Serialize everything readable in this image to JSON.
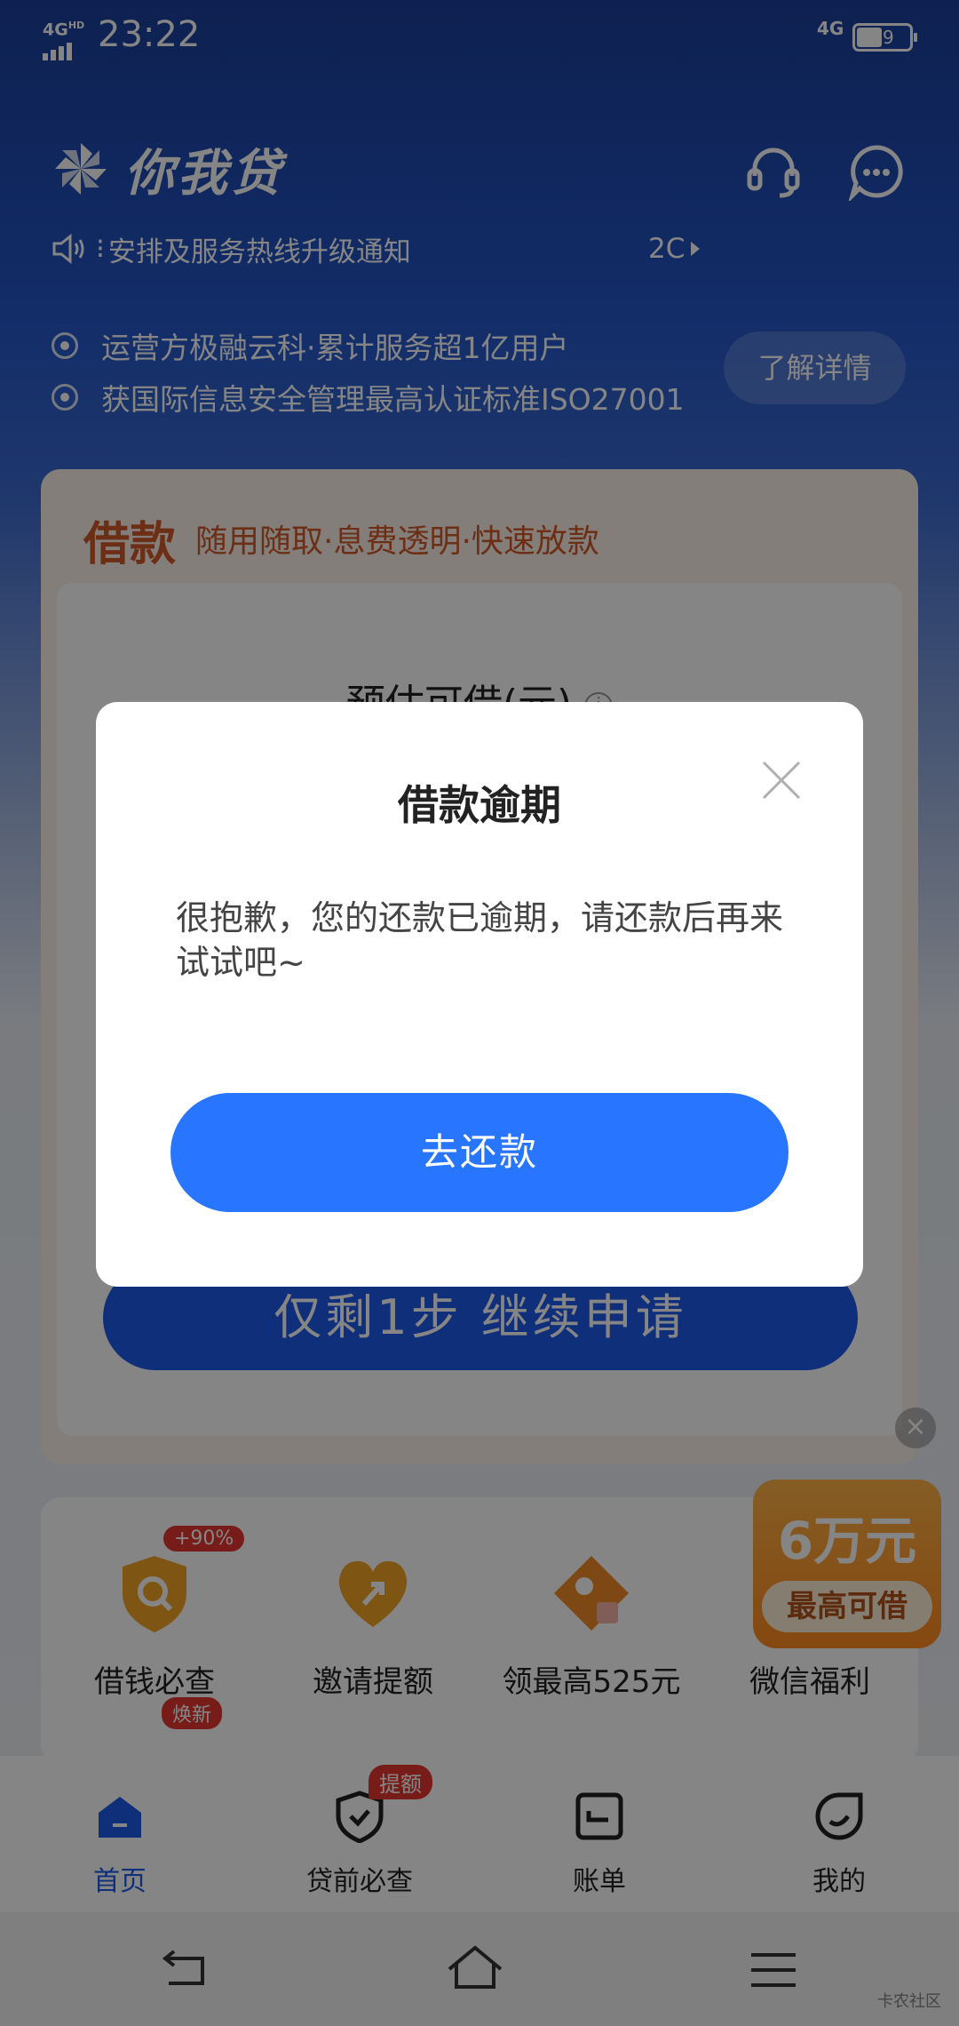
{
  "status_bar": {
    "network_left": "4G",
    "network_left_sup": "HD",
    "time": "23:22",
    "network_right": "4G",
    "battery": "49"
  },
  "header": {
    "app_name": "你我贷",
    "logo_icon": "pinwheel-logo",
    "support_icon": "headset-icon",
    "message_icon": "chat-bubble-icon"
  },
  "notice": {
    "icon": "speaker-icon",
    "text": "安排及服务热线升级通知",
    "date": "2C"
  },
  "trust": {
    "lines": [
      "运营方极融云科·累计服务超1亿用户",
      "获国际信息安全管理最高认证标准ISO27001"
    ],
    "learn_more": "了解详情"
  },
  "loan_card": {
    "title": "借款",
    "subtitle": "随用随取·息费透明·快速放款",
    "estimate_label": "预估可借(元)",
    "continue_button": "仅剩1步 继续申请"
  },
  "features": {
    "items": [
      {
        "label": "借钱必查",
        "icon": "shield-search-icon",
        "badge": "+90%"
      },
      {
        "label": "邀请提额",
        "icon": "heart-arrow-icon",
        "badge": ""
      },
      {
        "label": "领最高525元",
        "icon": "coupon-tag-icon",
        "badge": ""
      },
      {
        "label": "微信福利",
        "icon": "wechat-gift-icon",
        "badge": ""
      }
    ],
    "second_row_badge": "焕新"
  },
  "floating_ad": {
    "amount": "6万元",
    "tag": "最高可借"
  },
  "tabbar": {
    "tabs": [
      {
        "label": "首页",
        "icon": "home-icon",
        "active": true
      },
      {
        "label": "贷前必查",
        "icon": "shield-check-icon",
        "badge": "提额"
      },
      {
        "label": "账单",
        "icon": "bill-icon"
      },
      {
        "label": "我的",
        "icon": "profile-icon"
      }
    ]
  },
  "navbar": {
    "back_icon": "back-icon",
    "home_icon": "home-outline-icon",
    "menu_icon": "menu-icon"
  },
  "watermark": "卡农社区",
  "dialog": {
    "title": "借款逾期",
    "message": "很抱歉，您的还款已逾期，请还款后再来试试吧~",
    "button": "去还款",
    "close_icon": "close-icon"
  },
  "colors": {
    "primary_blue": "#2876ff",
    "brand_blue": "#1e5bea",
    "loan_orange": "#d1592b",
    "badge_red": "#e5362f"
  }
}
